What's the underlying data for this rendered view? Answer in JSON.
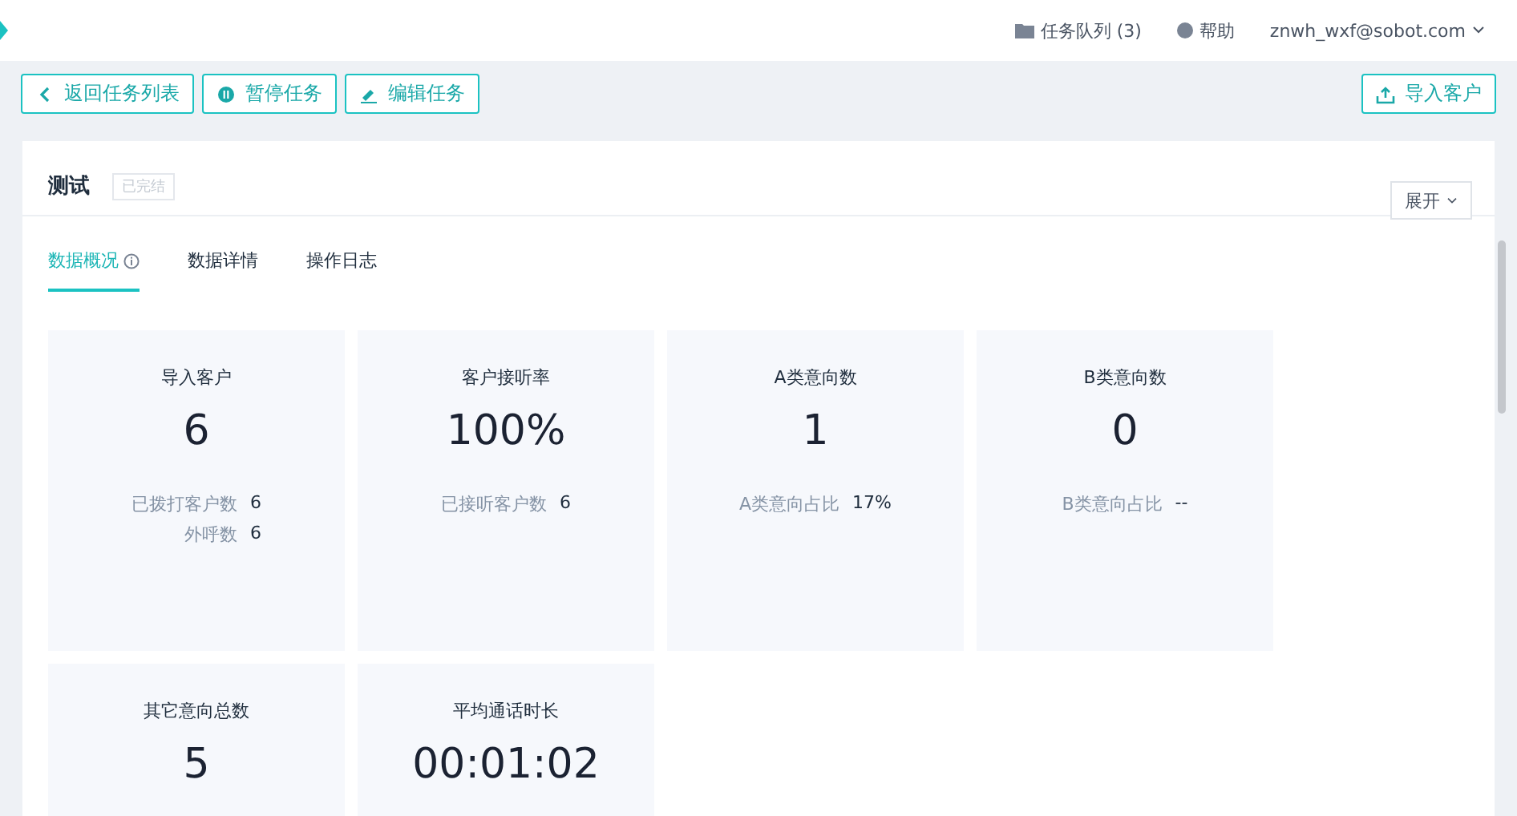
{
  "header": {
    "queue": "任务队列 (3)",
    "help": "帮助",
    "user": "znwh_wxf@sobot.com"
  },
  "toolbar": {
    "left_buttons": [
      {
        "kind": "back",
        "label": "返回任务列表"
      },
      {
        "kind": "pause",
        "label": "暂停任务"
      },
      {
        "kind": "edit",
        "label": "编辑任务"
      }
    ],
    "right_button": {
      "kind": "import",
      "label": "导入客户"
    }
  },
  "task": {
    "title": "测试",
    "status": "已完结",
    "expand": "展开"
  },
  "tabs": [
    {
      "label": "数据概况",
      "selected": true,
      "info": true
    },
    {
      "label": "数据详情",
      "selected": false,
      "info": false
    },
    {
      "label": "操作日志",
      "selected": false,
      "info": false
    }
  ],
  "cards": [
    {
      "title": "导入客户",
      "value": "6",
      "stats": [
        {
          "label": "已拨打客户数",
          "value": "6"
        },
        {
          "label": "外呼数",
          "value": "6"
        }
      ]
    },
    {
      "title": "客户接听率",
      "value": "100%",
      "stats": [
        {
          "label": "已接听客户数",
          "value": "6"
        }
      ]
    },
    {
      "title": "A类意向数",
      "value": "1",
      "stats": [
        {
          "label": "A类意向占比",
          "value": "17%"
        }
      ]
    },
    {
      "title": "B类意向数",
      "value": "0",
      "stats": [
        {
          "label": "B类意向占比",
          "value": "--"
        }
      ]
    },
    {
      "title": "其它意向总数",
      "value": "5"
    },
    {
      "title": "平均通话时长",
      "value": "00:01:02"
    }
  ]
}
